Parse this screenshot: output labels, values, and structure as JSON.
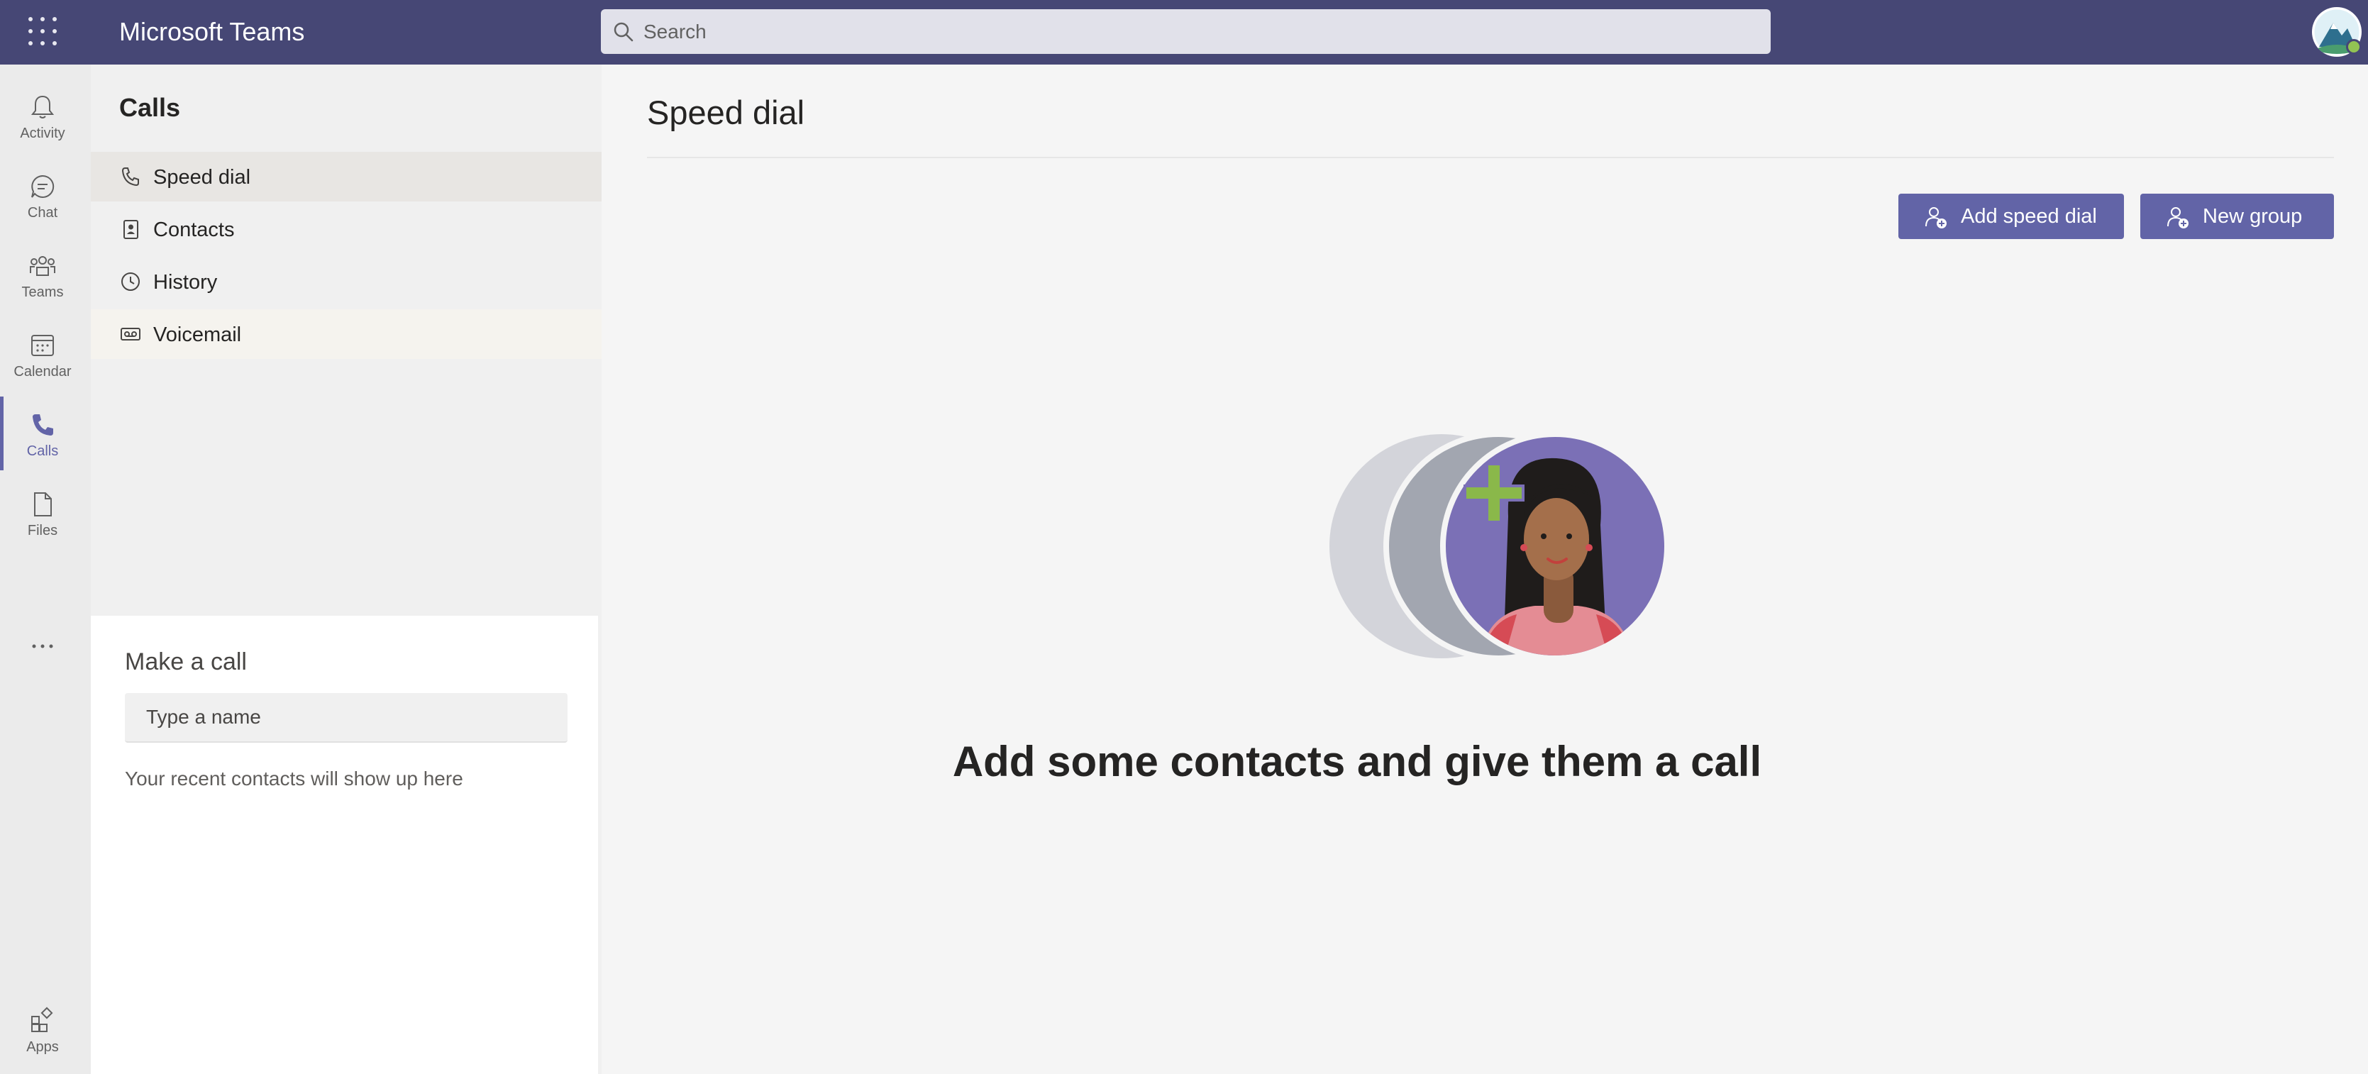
{
  "app": {
    "title": "Microsoft Teams"
  },
  "search": {
    "placeholder": "Search"
  },
  "rail": {
    "items": [
      {
        "label": "Activity",
        "icon": "bell-icon"
      },
      {
        "label": "Chat",
        "icon": "chat-icon"
      },
      {
        "label": "Teams",
        "icon": "teams-icon"
      },
      {
        "label": "Calendar",
        "icon": "calendar-icon"
      },
      {
        "label": "Calls",
        "icon": "phone-icon",
        "active": true
      },
      {
        "label": "Files",
        "icon": "file-icon"
      }
    ],
    "more_icon": "more-icon",
    "apps_label": "Apps"
  },
  "calls": {
    "title": "Calls",
    "nav": [
      {
        "label": "Speed dial",
        "icon": "phone-icon",
        "selected": true
      },
      {
        "label": "Contacts",
        "icon": "contacts-icon"
      },
      {
        "label": "History",
        "icon": "clock-icon"
      },
      {
        "label": "Voicemail",
        "icon": "voicemail-icon"
      }
    ],
    "make_call": {
      "title": "Make a call",
      "input_placeholder": "Type a name",
      "recent_hint": "Your recent contacts will show up here"
    }
  },
  "main": {
    "title": "Speed dial",
    "add_speed_dial_label": "Add speed dial",
    "new_group_label": "New group",
    "empty_message": "Add some contacts and give them a call"
  },
  "colors": {
    "topbar": "#464775",
    "accent": "#6264a7",
    "presence": "#92c353"
  }
}
